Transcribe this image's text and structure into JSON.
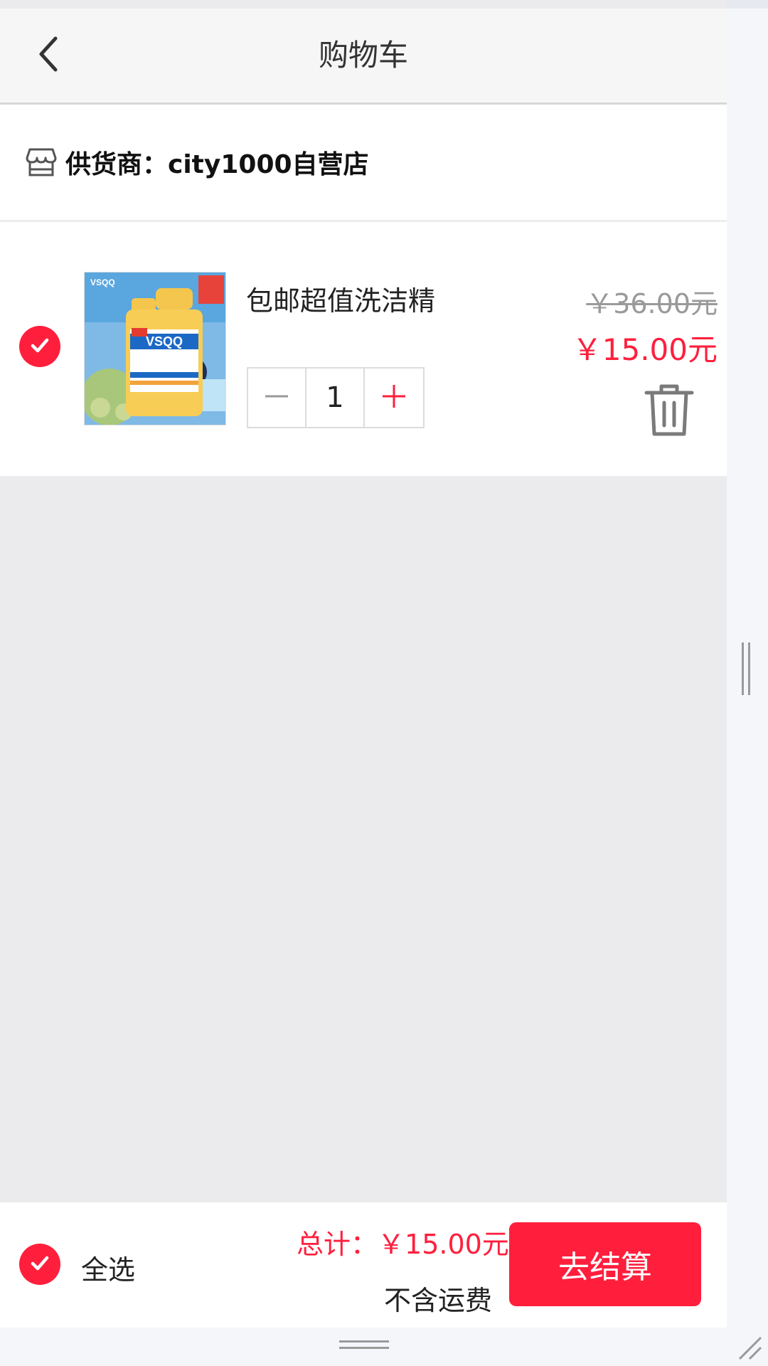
{
  "header": {
    "title": "购物车",
    "back_icon": "chevron-left-icon"
  },
  "supplier": {
    "icon": "store-icon",
    "label": "供货商：city1000自营店"
  },
  "cart": {
    "items": [
      {
        "name": "包邮超值洗洁精",
        "original_price": "￥36.00元",
        "price": "￥15.00元",
        "quantity": "1",
        "selected": true,
        "image_icon": "product-image-dish-soap"
      }
    ]
  },
  "footer": {
    "select_all_label": "全选",
    "total_label": "总计：",
    "total_value": "￥15.00元",
    "shipping_note": "不含运费",
    "checkout_label": "去结算"
  },
  "colors": {
    "accent": "#ff1f3d",
    "background": "#ebebee",
    "header_bg": "#f6f6f6"
  }
}
